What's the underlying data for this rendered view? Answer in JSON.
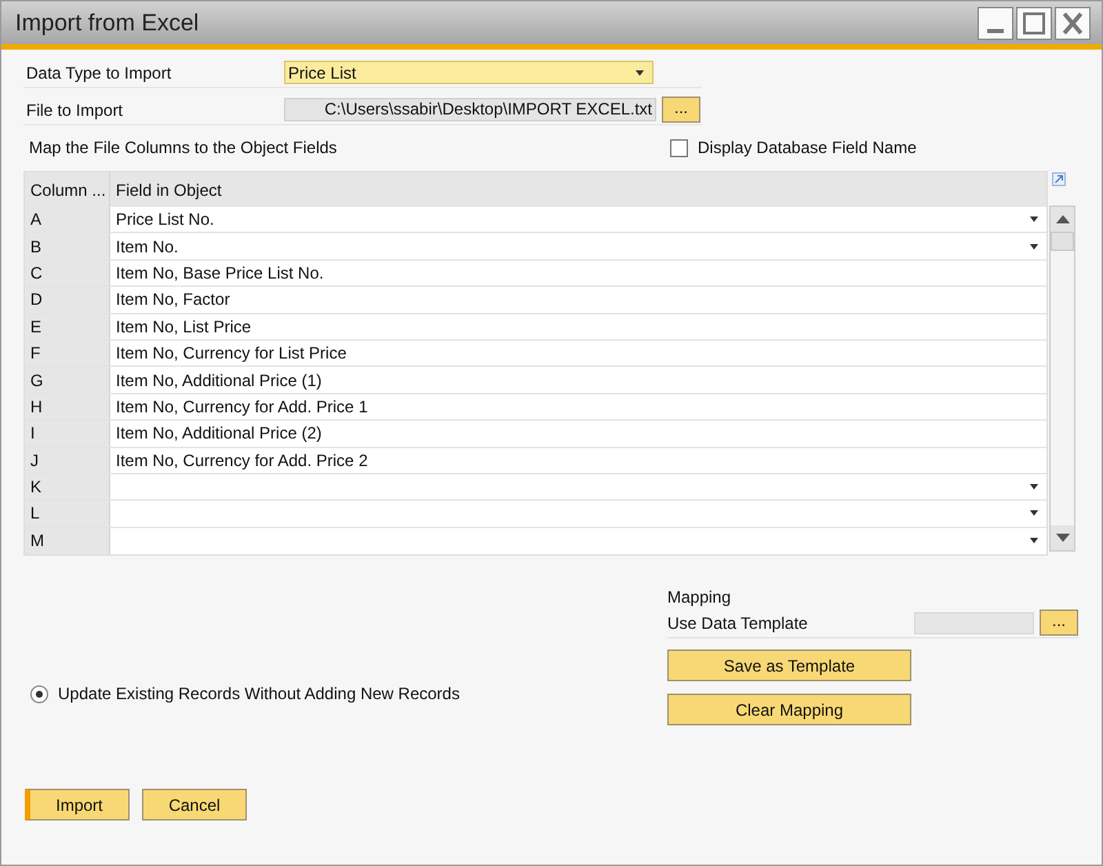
{
  "window": {
    "title": "Import from Excel"
  },
  "data_type": {
    "label": "Data Type to Import",
    "value": "Price List"
  },
  "file": {
    "label": "File to Import",
    "value": "C:\\Users\\ssabir\\Desktop\\IMPORT EXCEL.txt",
    "browse": "..."
  },
  "map_label": "Map the File Columns to the Object Fields",
  "display_db_field": {
    "label": "Display Database Field Name",
    "checked": false
  },
  "table": {
    "columns": [
      "Column ...",
      "Field in Object"
    ],
    "rows": [
      {
        "column": "A",
        "field": "Price List No.",
        "dropdown": true
      },
      {
        "column": "B",
        "field": "Item No.",
        "dropdown": true
      },
      {
        "column": "C",
        "field": "Item No, Base Price List No.",
        "dropdown": false
      },
      {
        "column": "D",
        "field": "Item No, Factor",
        "dropdown": false
      },
      {
        "column": "E",
        "field": "Item No, List Price",
        "dropdown": false
      },
      {
        "column": "F",
        "field": "Item No, Currency for List Price",
        "dropdown": false
      },
      {
        "column": "G",
        "field": "Item No, Additional Price (1)",
        "dropdown": false
      },
      {
        "column": "H",
        "field": "Item No, Currency for Add. Price 1",
        "dropdown": false
      },
      {
        "column": "I",
        "field": "Item No, Additional Price (2)",
        "dropdown": false
      },
      {
        "column": "J",
        "field": "Item No, Currency for Add. Price 2",
        "dropdown": false
      },
      {
        "column": "K",
        "field": "",
        "dropdown": true
      },
      {
        "column": "L",
        "field": "",
        "dropdown": true
      },
      {
        "column": "M",
        "field": "",
        "dropdown": true
      }
    ]
  },
  "mapping": {
    "title": "Mapping",
    "template_label": "Use Data Template",
    "browse": "...",
    "buttons": [
      "Save as Template",
      "Clear Mapping"
    ]
  },
  "update_option": {
    "label": "Update Existing Records Without Adding New Records",
    "selected": true
  },
  "buttons": [
    {
      "label": "Import",
      "default": true
    },
    {
      "label": "Cancel",
      "default": false
    }
  ]
}
